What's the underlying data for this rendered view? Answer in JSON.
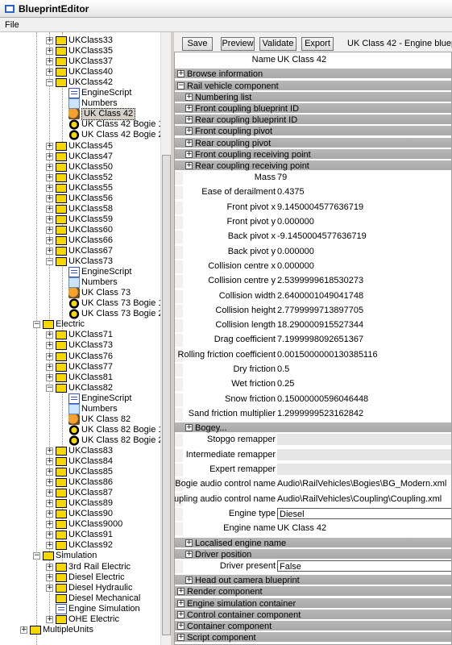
{
  "window": {
    "title": "BlueprintEditor"
  },
  "menu": {
    "file": "File"
  },
  "tree": {
    "items": [
      {
        "label": "UKClass33",
        "icon": "folder-icon",
        "exp": "+",
        "depth": 2
      },
      {
        "label": "UKClass35",
        "icon": "folder-icon",
        "exp": "+",
        "depth": 2
      },
      {
        "label": "UKClass37",
        "icon": "folder-icon",
        "exp": "+",
        "depth": 2
      },
      {
        "label": "UKClass40",
        "icon": "folder-icon",
        "exp": "+",
        "depth": 2
      },
      {
        "label": "UKClass42",
        "icon": "folder-icon",
        "exp": "-",
        "depth": 2
      },
      {
        "label": "EngineScript",
        "icon": "script-icon",
        "exp": "",
        "depth": 3
      },
      {
        "label": "Numbers",
        "icon": "numbers-icon",
        "exp": "",
        "depth": 3
      },
      {
        "label": "UK Class 42",
        "icon": "loco-icon",
        "exp": "",
        "depth": 3,
        "selected": true
      },
      {
        "label": "UK Class 42 Bogie 1",
        "icon": "bogie-icon",
        "exp": "",
        "depth": 3
      },
      {
        "label": "UK Class 42 Bogie 2",
        "icon": "bogie-icon",
        "exp": "",
        "depth": 3
      },
      {
        "label": "UKClass45",
        "icon": "folder-icon",
        "exp": "+",
        "depth": 2
      },
      {
        "label": "UKClass47",
        "icon": "folder-icon",
        "exp": "+",
        "depth": 2
      },
      {
        "label": "UKClass50",
        "icon": "folder-icon",
        "exp": "+",
        "depth": 2
      },
      {
        "label": "UKClass52",
        "icon": "folder-icon",
        "exp": "+",
        "depth": 2
      },
      {
        "label": "UKClass55",
        "icon": "folder-icon",
        "exp": "+",
        "depth": 2
      },
      {
        "label": "UKClass56",
        "icon": "folder-icon",
        "exp": "+",
        "depth": 2
      },
      {
        "label": "UKClass58",
        "icon": "folder-icon",
        "exp": "+",
        "depth": 2
      },
      {
        "label": "UKClass59",
        "icon": "folder-icon",
        "exp": "+",
        "depth": 2
      },
      {
        "label": "UKClass60",
        "icon": "folder-icon",
        "exp": "+",
        "depth": 2
      },
      {
        "label": "UKClass66",
        "icon": "folder-icon",
        "exp": "+",
        "depth": 2
      },
      {
        "label": "UKClass67",
        "icon": "folder-icon",
        "exp": "+",
        "depth": 2
      },
      {
        "label": "UKClass73",
        "icon": "folder-icon",
        "exp": "-",
        "depth": 2
      },
      {
        "label": "EngineScript",
        "icon": "script-icon",
        "exp": "",
        "depth": 3
      },
      {
        "label": "Numbers",
        "icon": "numbers-icon",
        "exp": "",
        "depth": 3
      },
      {
        "label": "UK Class 73",
        "icon": "loco-icon",
        "exp": "",
        "depth": 3
      },
      {
        "label": "UK Class 73 Bogie 1",
        "icon": "bogie-icon",
        "exp": "",
        "depth": 3
      },
      {
        "label": "UK Class 73 Bogie 2",
        "icon": "bogie-icon",
        "exp": "",
        "depth": 3
      },
      {
        "label": "Electric",
        "icon": "folder-icon",
        "exp": "-",
        "depth": 1
      },
      {
        "label": "UKClass71",
        "icon": "folder-icon",
        "exp": "+",
        "depth": 2
      },
      {
        "label": "UKClass73",
        "icon": "folder-icon",
        "exp": "+",
        "depth": 2
      },
      {
        "label": "UKClass76",
        "icon": "folder-icon",
        "exp": "+",
        "depth": 2
      },
      {
        "label": "UKClass77",
        "icon": "folder-icon",
        "exp": "+",
        "depth": 2
      },
      {
        "label": "UKClass81",
        "icon": "folder-icon",
        "exp": "+",
        "depth": 2
      },
      {
        "label": "UKClass82",
        "icon": "folder-icon",
        "exp": "-",
        "depth": 2
      },
      {
        "label": "EngineScript",
        "icon": "script-icon",
        "exp": "",
        "depth": 3
      },
      {
        "label": "Numbers",
        "icon": "numbers-icon",
        "exp": "",
        "depth": 3
      },
      {
        "label": "UK Class 82",
        "icon": "loco-icon",
        "exp": "",
        "depth": 3
      },
      {
        "label": "UK Class 82 Bogie 1",
        "icon": "bogie-icon",
        "exp": "",
        "depth": 3
      },
      {
        "label": "UK Class 82 Bogie 2",
        "icon": "bogie-icon",
        "exp": "",
        "depth": 3
      },
      {
        "label": "UKClass83",
        "icon": "folder-icon",
        "exp": "+",
        "depth": 2
      },
      {
        "label": "UKClass84",
        "icon": "folder-icon",
        "exp": "+",
        "depth": 2
      },
      {
        "label": "UKClass85",
        "icon": "folder-icon",
        "exp": "+",
        "depth": 2
      },
      {
        "label": "UKClass86",
        "icon": "folder-icon",
        "exp": "+",
        "depth": 2
      },
      {
        "label": "UKClass87",
        "icon": "folder-icon",
        "exp": "+",
        "depth": 2
      },
      {
        "label": "UKClass89",
        "icon": "folder-icon",
        "exp": "+",
        "depth": 2
      },
      {
        "label": "UKClass90",
        "icon": "folder-icon",
        "exp": "+",
        "depth": 2
      },
      {
        "label": "UKClass9000",
        "icon": "folder-icon",
        "exp": "+",
        "depth": 2
      },
      {
        "label": "UKClass91",
        "icon": "folder-icon",
        "exp": "+",
        "depth": 2
      },
      {
        "label": "UKClass92",
        "icon": "folder-icon",
        "exp": "+",
        "depth": 2
      },
      {
        "label": "Simulation",
        "icon": "folder-icon",
        "exp": "-",
        "depth": 1
      },
      {
        "label": "3rd Rail Electric",
        "icon": "folder-icon",
        "exp": "+",
        "depth": 2
      },
      {
        "label": "Diesel Electric",
        "icon": "folder-icon",
        "exp": "+",
        "depth": 2
      },
      {
        "label": "Diesel Hydraulic",
        "icon": "folder-icon",
        "exp": "+",
        "depth": 2
      },
      {
        "label": "Diesel Mechanical",
        "icon": "folder-icon",
        "exp": "",
        "depth": 2
      },
      {
        "label": "Engine Simulation",
        "icon": "script-icon",
        "exp": "",
        "depth": 2
      },
      {
        "label": "OHE Electric",
        "icon": "folder-icon",
        "exp": "+",
        "depth": 2
      },
      {
        "label": "MultipleUnits",
        "icon": "folder-icon",
        "exp": "+",
        "depth": 0
      }
    ]
  },
  "toolbar": {
    "save": "Save",
    "preview": "Preview",
    "validate": "Validate",
    "export": "Export",
    "blueprint_title": "UK Class 42 - Engine blueprint"
  },
  "props": [
    {
      "type": "field",
      "label": "Name",
      "value": "UK Class 42",
      "indent": 0
    },
    {
      "type": "section",
      "exp": "+",
      "label": "Browse information",
      "indent": 0
    },
    {
      "type": "section",
      "exp": "-",
      "label": "Rail vehicle component",
      "indent": 0
    },
    {
      "type": "section",
      "exp": "+",
      "label": "Numbering list",
      "indent": 1
    },
    {
      "type": "section",
      "exp": "+",
      "label": "Front coupling blueprint ID",
      "indent": 1
    },
    {
      "type": "section",
      "exp": "+",
      "label": "Rear coupling blueprint ID",
      "indent": 1
    },
    {
      "type": "section",
      "exp": "+",
      "label": "Front coupling pivot",
      "indent": 1
    },
    {
      "type": "section",
      "exp": "+",
      "label": "Rear coupling pivot",
      "indent": 1
    },
    {
      "type": "section",
      "exp": "+",
      "label": "Front coupling receiving point",
      "indent": 1
    },
    {
      "type": "section",
      "exp": "+",
      "label": "Rear coupling receiving point",
      "indent": 1
    },
    {
      "type": "field",
      "label": "Mass",
      "value": "79",
      "indent": 1
    },
    {
      "type": "field",
      "label": "Ease of derailment",
      "value": "0.4375",
      "indent": 1
    },
    {
      "type": "field",
      "label": "Front pivot x",
      "value": "9.1450004577636719",
      "indent": 1
    },
    {
      "type": "field",
      "label": "Front pivot y",
      "value": "0.000000",
      "indent": 1
    },
    {
      "type": "field",
      "label": "Back pivot x",
      "value": "-9.1450004577636719",
      "indent": 1
    },
    {
      "type": "field",
      "label": "Back pivot y",
      "value": "0.000000",
      "indent": 1
    },
    {
      "type": "field",
      "label": "Collision centre x",
      "value": "0.000000",
      "indent": 1
    },
    {
      "type": "field",
      "label": "Collision centre y",
      "value": "2.5399999618530273",
      "indent": 1
    },
    {
      "type": "field",
      "label": "Collision width",
      "value": "2.6400001049041748",
      "indent": 1
    },
    {
      "type": "field",
      "label": "Collision height",
      "value": "2.7799999713897705",
      "indent": 1
    },
    {
      "type": "field",
      "label": "Collision length",
      "value": "18.290000915527344",
      "indent": 1
    },
    {
      "type": "field",
      "label": "Drag coefficient",
      "value": "7.1999998092651367",
      "indent": 1
    },
    {
      "type": "field",
      "label": "Rolling friction coefficient",
      "value": "0.0015000000130385116",
      "indent": 1
    },
    {
      "type": "field",
      "label": "Dry friction",
      "value": "0.5",
      "indent": 1
    },
    {
      "type": "field",
      "label": "Wet friction",
      "value": "0.25",
      "indent": 1
    },
    {
      "type": "field",
      "label": "Snow friction",
      "value": "0.15000000596046448",
      "indent": 1
    },
    {
      "type": "field",
      "label": "Sand friction multiplier",
      "value": "1.2999999523162842",
      "indent": 1
    },
    {
      "type": "section",
      "exp": "+",
      "label": "Bogey...",
      "indent": 1
    },
    {
      "type": "field",
      "label": "Stopgo remapper",
      "value": "",
      "indent": 1,
      "empty": true
    },
    {
      "type": "field",
      "label": "Intermediate remapper",
      "value": "",
      "indent": 1,
      "empty": true
    },
    {
      "type": "field",
      "label": "Expert remapper",
      "value": "",
      "indent": 1,
      "empty": true
    },
    {
      "type": "field",
      "label": "Bogie audio control name",
      "value": "Audio\\RailVehicles\\Bogies\\BG_Modern.xml",
      "indent": 1
    },
    {
      "type": "field",
      "label": "Coupling audio control name",
      "value": "Audio\\RailVehicles\\Coupling\\Coupling.xml",
      "indent": 1
    },
    {
      "type": "field",
      "label": "Engine type",
      "value": "Diesel",
      "indent": 1,
      "box": true
    },
    {
      "type": "field",
      "label": "Engine name",
      "value": "UK Class 42",
      "indent": 1
    },
    {
      "type": "section",
      "exp": "+",
      "label": "Localised engine name",
      "indent": 1
    },
    {
      "type": "section",
      "exp": "+",
      "label": "Driver position",
      "indent": 1
    },
    {
      "type": "field",
      "label": "Driver present",
      "value": "False",
      "indent": 1,
      "box": true
    },
    {
      "type": "section",
      "exp": "+",
      "label": "Head out camera blueprint",
      "indent": 1
    },
    {
      "type": "section",
      "exp": "+",
      "label": "Render component",
      "indent": 0
    },
    {
      "type": "section",
      "exp": "+",
      "label": "Engine simulation container",
      "indent": 0
    },
    {
      "type": "section",
      "exp": "+",
      "label": "Control container component",
      "indent": 0
    },
    {
      "type": "section",
      "exp": "+",
      "label": "Container component",
      "indent": 0
    },
    {
      "type": "section",
      "exp": "+",
      "label": "Script component",
      "indent": 0
    }
  ]
}
